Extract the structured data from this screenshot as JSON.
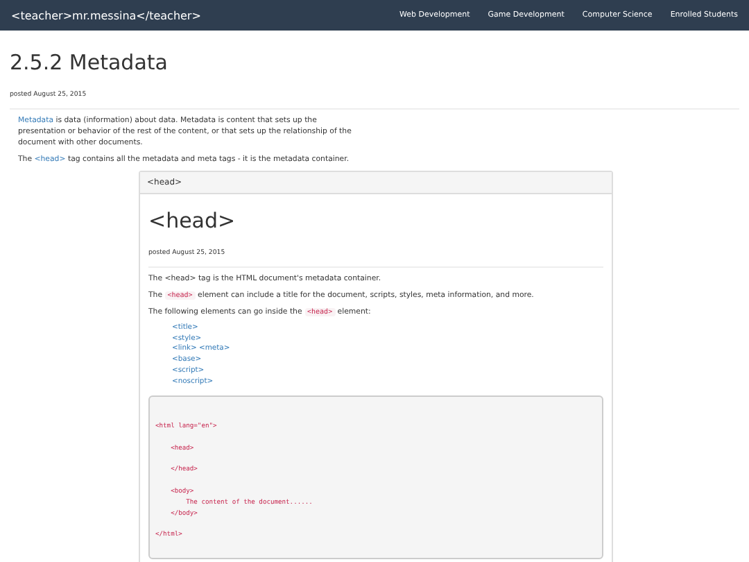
{
  "navbar": {
    "brand": "<teacher>mr.messina</teacher>",
    "links": [
      "Web Development",
      "Game Development",
      "Computer Science",
      "Enrolled Students"
    ]
  },
  "page": {
    "title": "2.5.2 Metadata",
    "posted": "posted August 25, 2015",
    "paragraphs": [
      [
        {
          "kind": "link",
          "text": "Metadata"
        },
        {
          "kind": "plain",
          "text": " is data (information) about data. Metadata is content that sets up the presentation or behavior of the rest of the content, or that sets up the relationship of the document with other documents."
        }
      ],
      [
        {
          "kind": "plain",
          "text": "The "
        },
        {
          "kind": "link",
          "text": "<head>"
        },
        {
          "kind": "plain",
          "text": " tag contains all the metadata and meta tags - it is the metadata container."
        }
      ]
    ]
  },
  "card": {
    "header": "<head>",
    "title": "<head>",
    "posted": "posted August 25, 2015",
    "paragraphs": [
      [
        {
          "kind": "plain",
          "text": "The <head> tag is the HTML document's metadata container."
        }
      ],
      [
        {
          "kind": "plain",
          "text": "The "
        },
        {
          "kind": "code",
          "text": "<head>"
        },
        {
          "kind": "plain",
          "text": " element can include a title for the document, scripts, styles, meta information, and more."
        }
      ],
      [
        {
          "kind": "plain",
          "text": "The following elements can go inside the "
        },
        {
          "kind": "code",
          "text": "<head>"
        },
        {
          "kind": "plain",
          "text": " element:"
        }
      ]
    ],
    "elements": [
      "<title>",
      "<style>",
      "<link> <meta>",
      "<base>",
      "<script>",
      "<noscript>"
    ],
    "code": "<html lang=\"en\">\n\n    <head>\n\n    </head>\n\n    <body>\n        The content of the document......\n    </body>\n\n</html>"
  }
}
